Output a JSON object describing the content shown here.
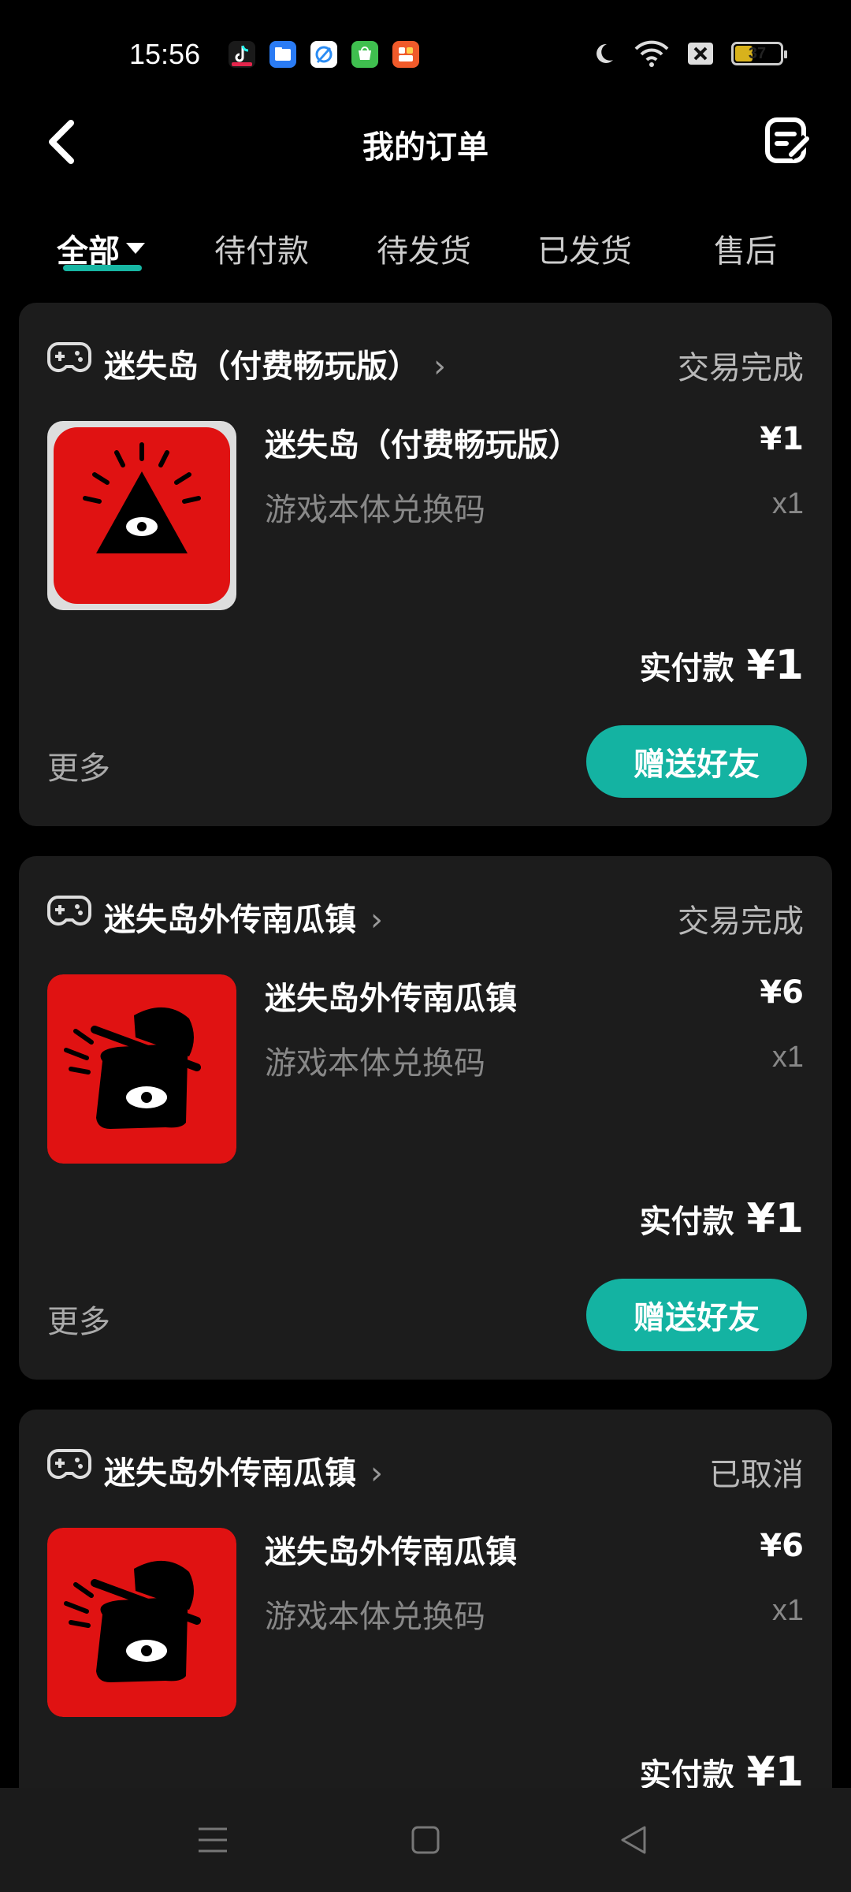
{
  "status_bar": {
    "time": "15:56",
    "notification_icons": [
      "tiktok-icon",
      "files-icon",
      "browser-icon",
      "market-icon",
      "shopping-icon"
    ],
    "battery_level": "37",
    "battery_fraction": 0.37
  },
  "header": {
    "title": "我的订单"
  },
  "tabs": [
    {
      "label": "全部",
      "active": true
    },
    {
      "label": "待付款",
      "active": false
    },
    {
      "label": "待发货",
      "active": false
    },
    {
      "label": "已发货",
      "active": false
    },
    {
      "label": "售后",
      "active": false
    }
  ],
  "orders": [
    {
      "store": "迷失岛（付费畅玩版）",
      "status": "交易完成",
      "product_name": "迷失岛（付费畅玩版）",
      "spec": "游戏本体兑换码",
      "price": "¥1",
      "qty": "x1",
      "paid_label": "实付款",
      "paid_amount": "¥1",
      "more": "更多",
      "gift_button": "赠送好友"
    },
    {
      "store": "迷失岛外传南瓜镇",
      "status": "交易完成",
      "product_name": "迷失岛外传南瓜镇",
      "spec": "游戏本体兑换码",
      "price": "¥6",
      "qty": "x1",
      "paid_label": "实付款",
      "paid_amount": "¥1",
      "more": "更多",
      "gift_button": "赠送好友"
    },
    {
      "store": "迷失岛外传南瓜镇",
      "status": "已取消",
      "product_name": "迷失岛外传南瓜镇",
      "spec": "游戏本体兑换码",
      "price": "¥6",
      "qty": "x1",
      "paid_label": "实付款",
      "paid_amount": "¥1"
    }
  ],
  "colors": {
    "accent": "#14b3a2",
    "card_bg": "#1c1c1c",
    "background": "#000000",
    "thumb_red": "#e01212"
  }
}
